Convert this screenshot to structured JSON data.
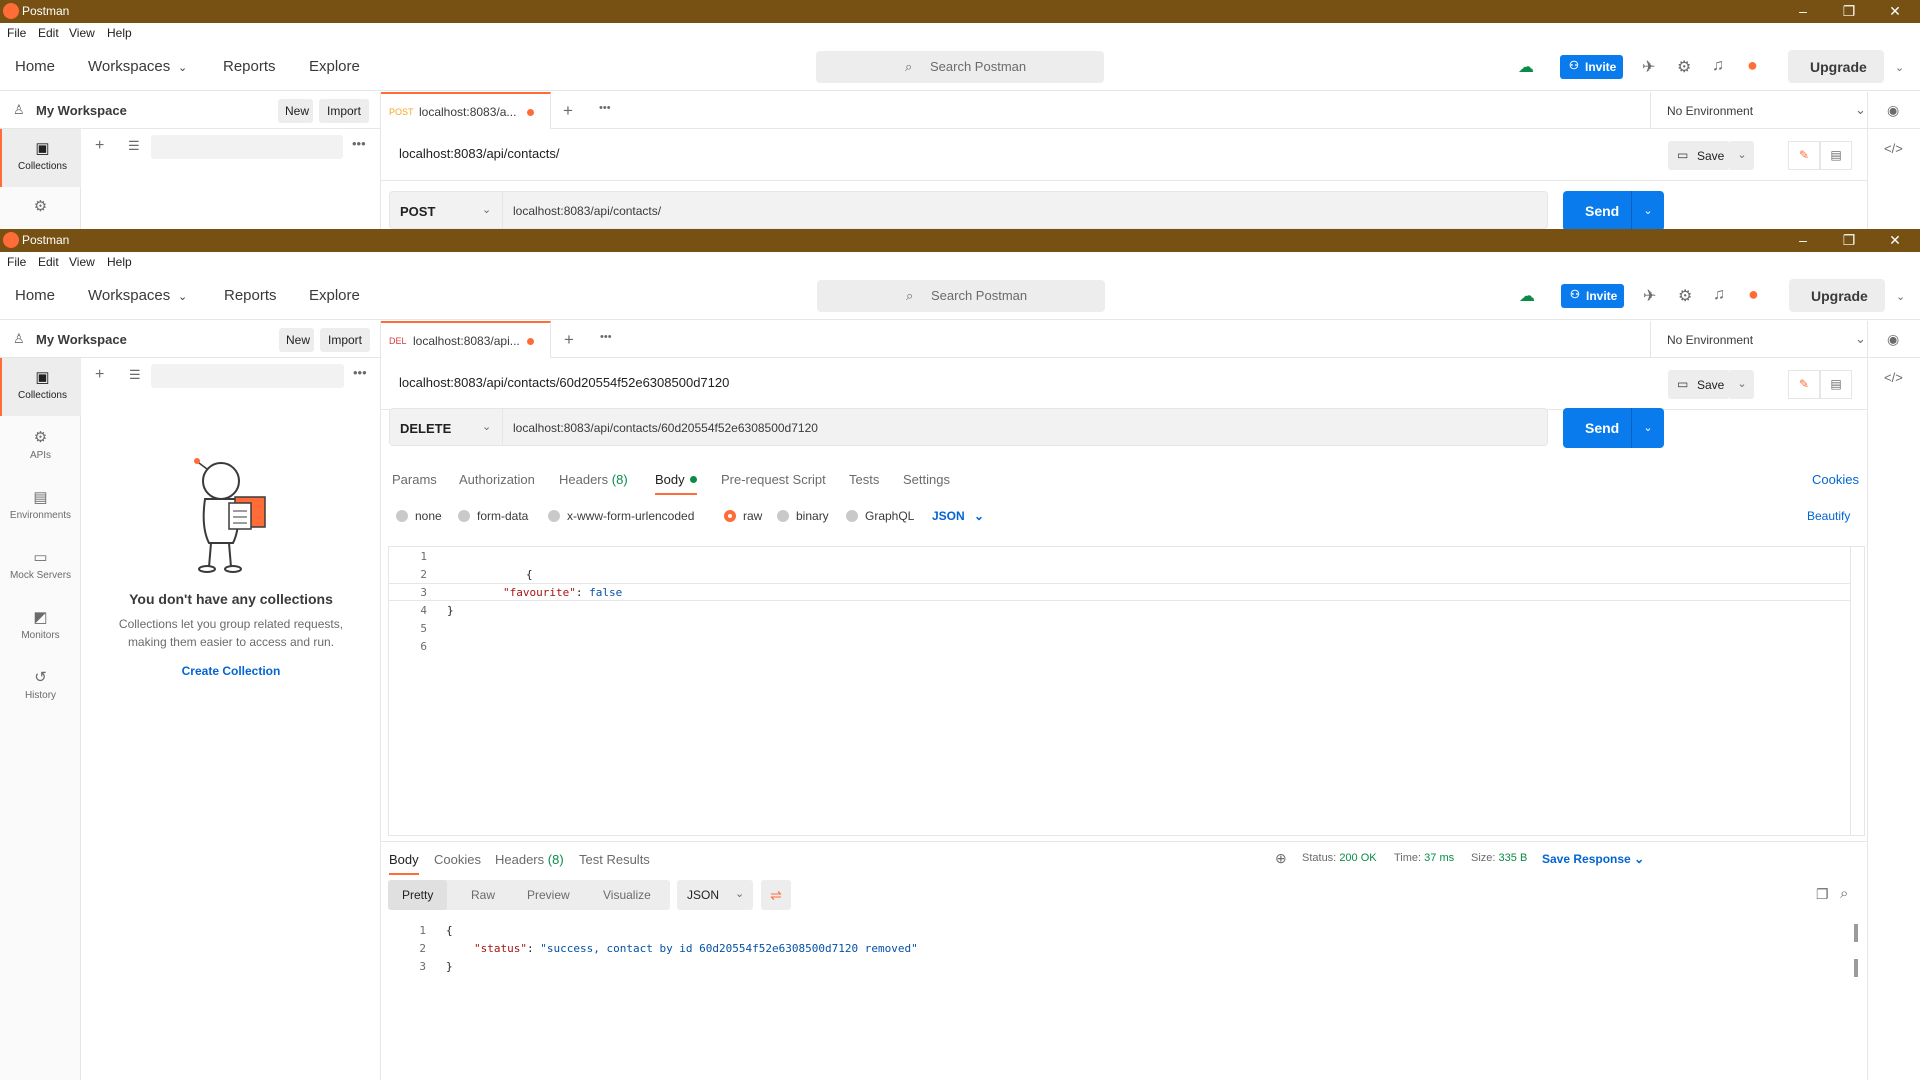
{
  "windows": {
    "back": {
      "title": "Postman",
      "menu": [
        "File",
        "Edit",
        "View",
        "Help"
      ],
      "nav": [
        "Home",
        "Workspaces",
        "Reports",
        "Explore"
      ],
      "search_placeholder": "Search Postman",
      "invite": "Invite",
      "upgrade": "Upgrade",
      "workspace": "My Workspace",
      "new_label": "New",
      "import_label": "Import",
      "rail_active": "Collections",
      "tab_method": "POST",
      "tab_label": "localhost:8083/a...",
      "environment": "No Environment",
      "request_title": "localhost:8083/api/contacts/",
      "save": "Save",
      "method": "POST",
      "url": "localhost:8083/api/contacts/",
      "send": "Send"
    },
    "front": {
      "title": "Postman",
      "menu": [
        "File",
        "Edit",
        "View",
        "Help"
      ],
      "nav": [
        "Home",
        "Workspaces",
        "Reports",
        "Explore"
      ],
      "search_placeholder": "Search Postman",
      "invite": "Invite",
      "upgrade": "Upgrade",
      "workspace": "My Workspace",
      "new_label": "New",
      "import_label": "Import",
      "rail": [
        {
          "label": "Collections",
          "icon": "collections-icon",
          "glyph": "▣"
        },
        {
          "label": "APIs",
          "icon": "apis-icon",
          "glyph": "⚙"
        },
        {
          "label": "Environments",
          "icon": "environments-icon",
          "glyph": "▤"
        },
        {
          "label": "Mock Servers",
          "icon": "mock-servers-icon",
          "glyph": "▭"
        },
        {
          "label": "Monitors",
          "icon": "monitors-icon",
          "glyph": "◩"
        },
        {
          "label": "History",
          "icon": "history-icon",
          "glyph": "↺"
        }
      ],
      "empty_title": "You don't have any collections",
      "empty_text_1": "Collections let you group related requests,",
      "empty_text_2": "making them easier to access and run.",
      "create_collection": "Create Collection",
      "tab_method": "DEL",
      "tab_label": "localhost:8083/api...",
      "environment": "No Environment",
      "request_title": "localhost:8083/api/contacts/60d20554f52e6308500d7120",
      "save": "Save",
      "method": "DELETE",
      "url": "localhost:8083/api/contacts/60d20554f52e6308500d7120",
      "send": "Send",
      "request_tabs": {
        "params": "Params",
        "authorization": "Authorization",
        "headers": "Headers",
        "headers_count": "(8)",
        "body": "Body",
        "pre_request": "Pre-request Script",
        "tests": "Tests",
        "settings": "Settings",
        "cookies": "Cookies"
      },
      "body_types": {
        "none": "none",
        "form_data": "form-data",
        "urlencoded": "x-www-form-urlencoded",
        "raw": "raw",
        "binary": "binary",
        "graphql": "GraphQL",
        "format": "JSON",
        "beautify": "Beautify"
      },
      "editor_lines": [
        "1",
        "2",
        "3",
        "4",
        "5",
        "6"
      ],
      "editor_code": {
        "line2": "{",
        "key": "\"favourite\"",
        "colon": ": ",
        "value": "false",
        "line4": "}"
      },
      "response_tabs": {
        "body": "Body",
        "cookies": "Cookies",
        "headers": "Headers",
        "headers_count": "(8)",
        "test_results": "Test Results"
      },
      "response_status": {
        "status_label": "Status:",
        "status_value": "200 OK",
        "time_label": "Time:",
        "time_value": "37 ms",
        "size_label": "Size:",
        "size_value": "335 B",
        "save_response": "Save Response"
      },
      "view_modes": [
        "Pretty",
        "Raw",
        "Preview",
        "Visualize"
      ],
      "view_format": "JSON",
      "response_lines": [
        "1",
        "2",
        "3"
      ],
      "response_code": {
        "open": "{",
        "key": "\"status\"",
        "colon": ": ",
        "value": "\"success, contact by id 60d20554f52e6308500d7120 removed\"",
        "close": "}"
      }
    }
  },
  "colors": {
    "titlebar": "#765113",
    "accent": "#ff6c37",
    "primary": "#097bed",
    "success": "#0a8c48"
  }
}
